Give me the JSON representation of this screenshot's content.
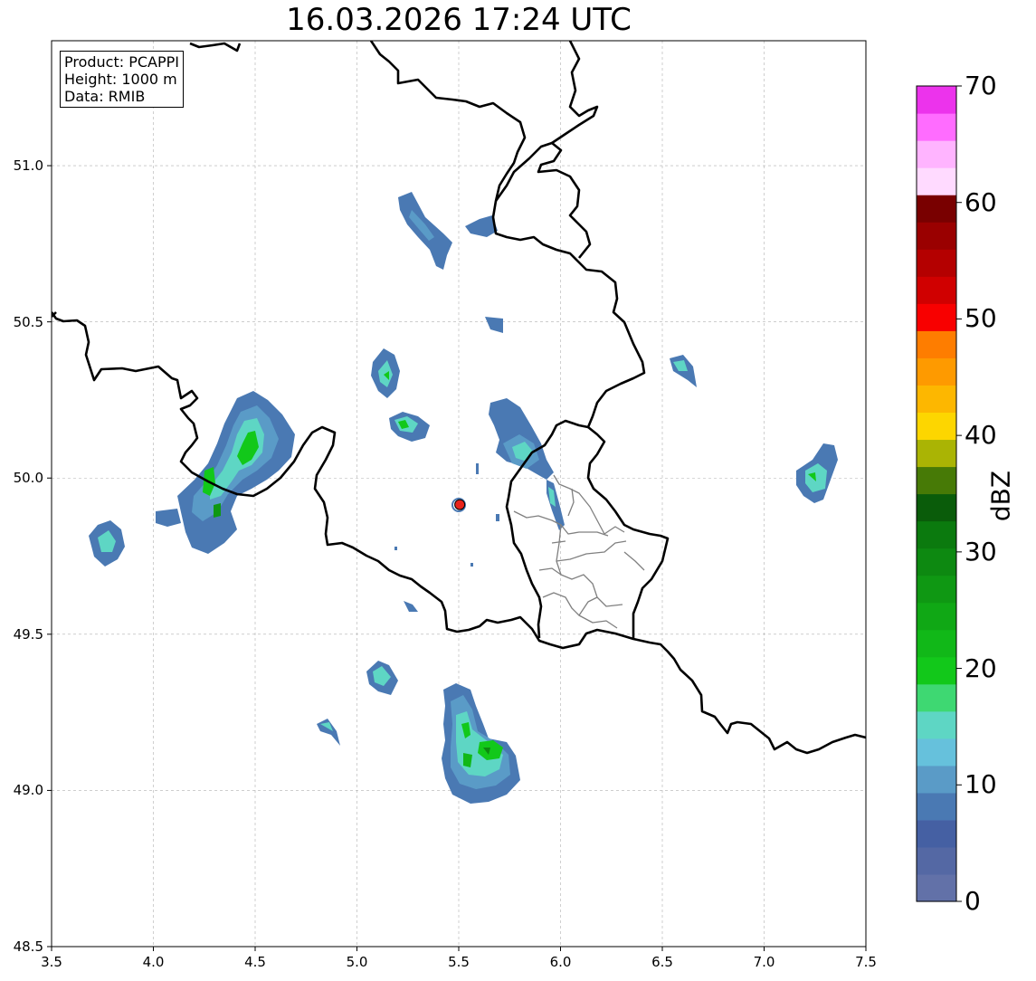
{
  "map": {
    "title": "16.03.2026 17:24 UTC",
    "info": {
      "product": "Product: PCAPPI",
      "height": "Height: 1000 m",
      "data": "Data: RMIB"
    },
    "extent": {
      "lon": [
        3.5,
        7.5
      ],
      "lat": [
        48.5,
        51.4
      ]
    },
    "lon_ticks": [
      "3.5",
      "4.0",
      "4.5",
      "5.0",
      "5.5",
      "6.0",
      "6.5",
      "7.0",
      "7.5"
    ],
    "lat_ticks": [
      "48.5",
      "49.0",
      "49.5",
      "50.0",
      "50.5",
      "51.0"
    ],
    "radar_site": {
      "lon": 5.505,
      "lat": 49.915,
      "color": "#e8231c"
    },
    "grid": true
  },
  "colorbar": {
    "label": "dBZ",
    "min": 0,
    "max": 70,
    "ticks": [
      "0",
      "10",
      "20",
      "30",
      "40",
      "50",
      "60",
      "70"
    ],
    "colors": [
      "#6271a8",
      "#5468a4",
      "#4560a3",
      "#4a79b3",
      "#5a9bc7",
      "#66c1dc",
      "#5ed6c4",
      "#3ed872",
      "#12c81a",
      "#11b818",
      "#10a815",
      "#0f9813",
      "#0d8911",
      "#0b7a0e",
      "#0a5c0a",
      "#477a06",
      "#aab404",
      "#fdd600",
      "#fdb700",
      "#fe9a00",
      "#fe7d00",
      "#f80000",
      "#d00000",
      "#b40000",
      "#9a0000",
      "#790000",
      "#ffdaff",
      "#ffb4ff",
      "#ff6cff",
      "#ec33ec"
    ]
  }
}
